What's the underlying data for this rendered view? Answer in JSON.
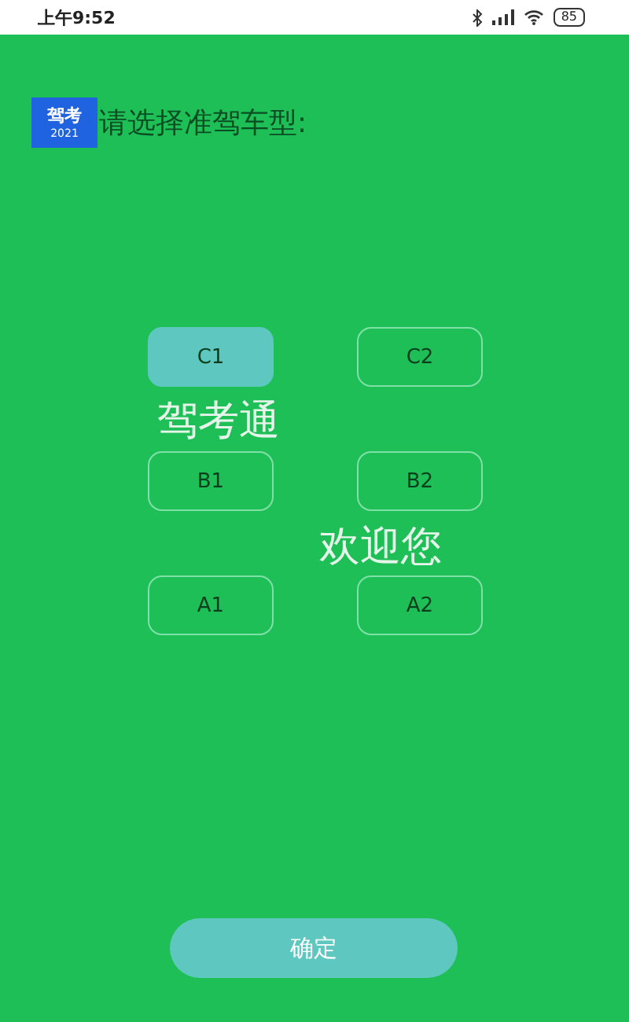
{
  "status_bar": {
    "time": "上午9:52",
    "battery": "85"
  },
  "header": {
    "logo_title": "驾考",
    "logo_year": "2021",
    "prompt": "请选择准驾车型:"
  },
  "license_types": [
    {
      "label": "C1",
      "selected": true
    },
    {
      "label": "C2",
      "selected": false
    },
    {
      "label": "B1",
      "selected": false
    },
    {
      "label": "B2",
      "selected": false
    },
    {
      "label": "A1",
      "selected": false
    },
    {
      "label": "A2",
      "selected": false
    }
  ],
  "overlay_texts": [
    "驾考通",
    "欢迎您"
  ],
  "confirm_button": "确定"
}
